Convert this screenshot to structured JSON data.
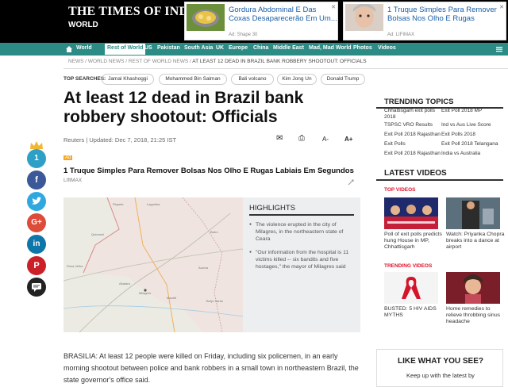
{
  "header": {
    "logo": "THE TIMES OF INDIA",
    "section": "WORLD",
    "ads": [
      {
        "title": "Gordura Abdominal E Das Coxas Desaparecerão Em Um...",
        "source": "Ad: Shape 30"
      },
      {
        "title": "1 Truque Simples Para Remover Bolsas Nos Olho E Rugas",
        "source": "Ad: LIFIMAX"
      }
    ],
    "ad_close": "✕"
  },
  "nav": {
    "items": [
      "World",
      "Rest of World",
      "US",
      "Pakistan",
      "South Asia",
      "UK",
      "Europe",
      "China",
      "Middle East",
      "Mad, Mad World",
      "Photos",
      "Videos"
    ],
    "active": "Rest of World"
  },
  "breadcrumbs": [
    "NEWS",
    "WORLD NEWS",
    "REST OF WORLD NEWS",
    "AT LEAST 12 DEAD IN BRAZIL BANK ROBBERY SHOOTOUT: OFFICIALS"
  ],
  "top_searches": {
    "label": "TOP SEARCHES:",
    "items": [
      "Jamal Khashoggi",
      "Mohammed Bin Salman",
      "Bali volcano",
      "Kim Jong Un",
      "Donald Trump"
    ]
  },
  "article": {
    "headline": "At least 12 dead in Brazil bank robbery shootout: Officials",
    "byline": "Reuters | Updated: Dec 7, 2018, 21:25 IST",
    "tools": {
      "mail": "✉",
      "print": "⎙",
      "font_down": "A-",
      "font_up": "A+"
    },
    "ad_mark": "Ad",
    "ad_title": "1 Truque Simples Para Remover Bolsas Nos Olho E Rugas Labiais Em Segundos",
    "ad_source": "LIftMAX",
    "body": "BRASILIA: At least 12 people were killed on Friday, including six policemen, in an early morning shootout between police and bank robbers in a small town in northeastern Brazil, the state governor's office said."
  },
  "map_labels": [
    "Piquete",
    "Lagoinha",
    "Quimami",
    "Rosa Velha",
    "Barro",
    "Milagres",
    "Mauriti",
    "Brejo Santo",
    "Abaiara",
    "Aurora"
  ],
  "highlights": {
    "title": "HIGHLIGHTS",
    "items": [
      "The violence erupted in the city of Milagres, in the northeastern state of Ceara",
      "\"Our information from the hospital is 11 victims killed -- six bandits and five hostages,\" the mayor of Milagres said"
    ]
  },
  "share": {
    "count": "1"
  },
  "trending": {
    "title": "TRENDING TOPICS",
    "items": [
      "Chhattisgarh exit polls 2018",
      "Exit Poll 2018 MP",
      "TSPSC VRO Results",
      "Ind vs Aus Live Score",
      "Exit Poll 2018 Rajasthan",
      "Exit Polls 2018",
      "Exit Polls",
      "Exit Poll 2018 Telangana",
      "Exit Poll 2018 Rajasthan",
      "India vs Australia"
    ]
  },
  "videos": {
    "title": "LATEST VIDEOS",
    "top_tab": "TOP VIDEOS",
    "trending_tab": "TRENDING VIDEOS",
    "top": [
      "Poll of exit polls predicts hung House in MP, Chhattisgarh",
      "Watch: Priyanka Chopra breaks into a dance at airport"
    ],
    "trending": [
      "BUSTED: 5 HIV AIDS MYTHS",
      "Home remedies to relieve throbbing sinus headache"
    ]
  },
  "like_box": {
    "title": "LIKE WHAT YOU SEE?",
    "subtitle": "Keep up with the latest by"
  }
}
